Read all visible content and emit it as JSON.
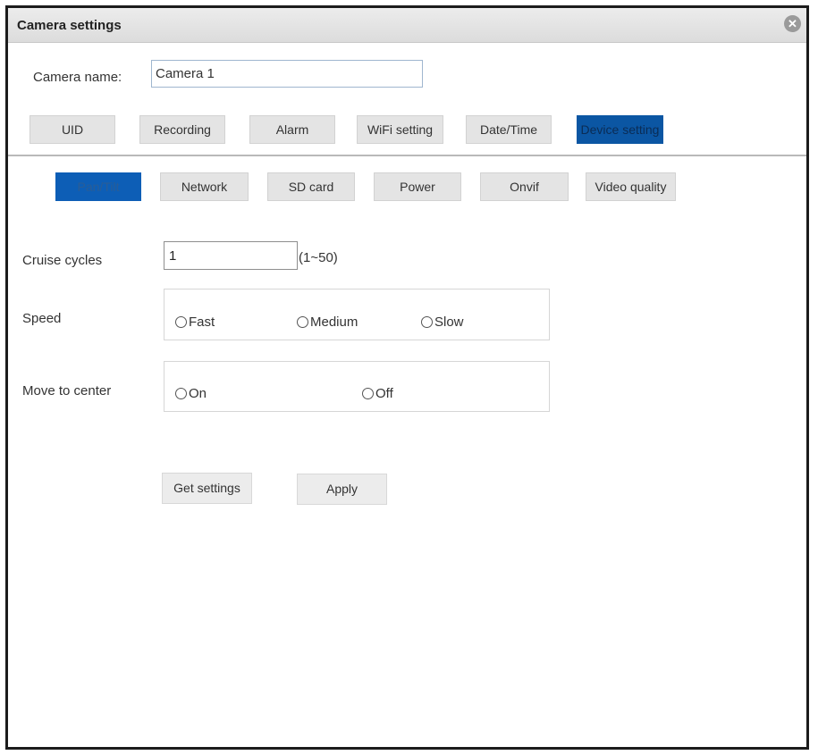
{
  "dialog": {
    "title": "Camera settings",
    "close_icon": "close-icon"
  },
  "camera_name": {
    "label": "Camera name:",
    "value": "Camera 1"
  },
  "main_tabs": [
    {
      "label": "UID"
    },
    {
      "label": "Recording"
    },
    {
      "label": "Alarm"
    },
    {
      "label": "WiFi setting"
    },
    {
      "label": "Date/Time"
    },
    {
      "label": "Device setting",
      "active": true
    }
  ],
  "sub_tabs": [
    {
      "label": "Pan/Tilt",
      "active": true
    },
    {
      "label": "Network"
    },
    {
      "label": "SD card"
    },
    {
      "label": "Power"
    },
    {
      "label": "Onvif"
    },
    {
      "label": "Video quality"
    }
  ],
  "cruise_cycles": {
    "label": "Cruise cycles",
    "value": "1",
    "range": "(1~50)"
  },
  "speed": {
    "label": "Speed",
    "options": [
      "Fast",
      "Medium",
      "Slow"
    ]
  },
  "move_to_center": {
    "label": "Move to center",
    "options": [
      "On",
      "Off"
    ]
  },
  "buttons": {
    "get_settings": "Get settings",
    "apply": "Apply"
  },
  "colors": {
    "active_tab": "#0b56a3",
    "title_bar": "#dcdcdc",
    "border": "#1c1c1c"
  }
}
